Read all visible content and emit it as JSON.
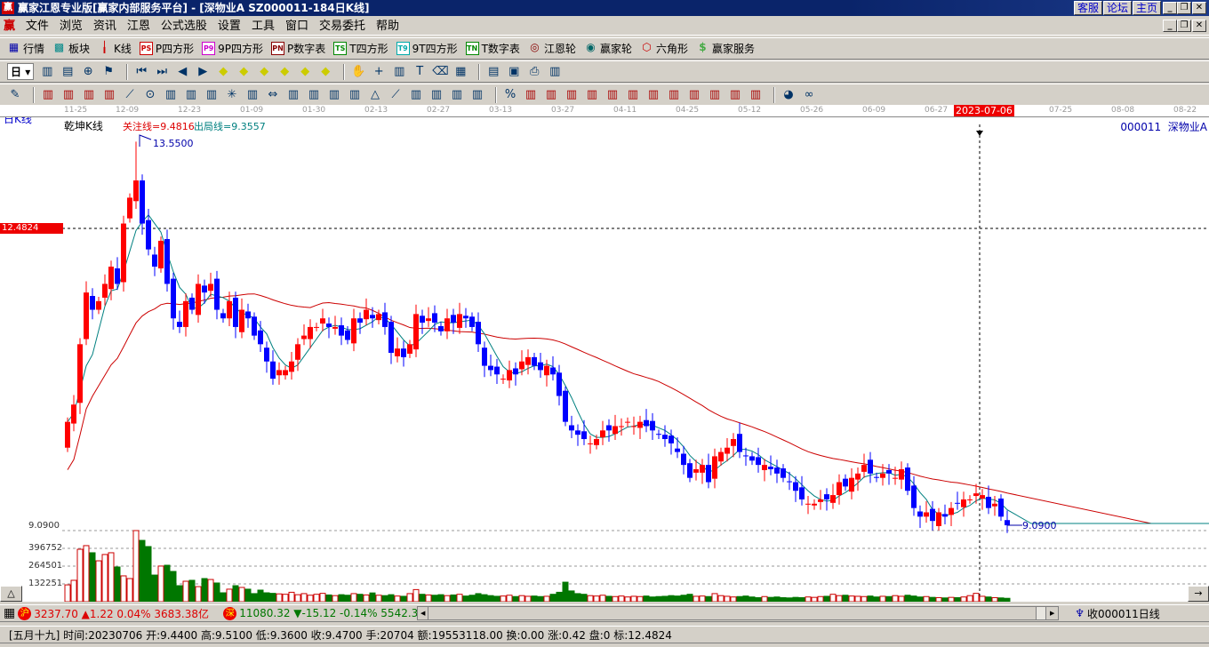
{
  "title": {
    "text": "赢家江恩专业版[赢家内部服务平台] - [深物业A   SZ000011-184日K线]",
    "logo": "赢",
    "links": [
      "客服",
      "论坛",
      "主页"
    ]
  },
  "menu": {
    "logo": "赢",
    "items": [
      "文件",
      "浏览",
      "资讯",
      "江恩",
      "公式选股",
      "设置",
      "工具",
      "窗口",
      "交易委托",
      "帮助"
    ]
  },
  "toolbar1": [
    {
      "icon": "grid-icon",
      "glyph": "▦",
      "label": "行情"
    },
    {
      "icon": "blocks-icon",
      "glyph": "▩",
      "label": "板块"
    },
    {
      "icon": "candles-icon",
      "glyph": "╽",
      "label": "K线"
    },
    {
      "icon": "ps-icon",
      "glyph": "PS",
      "label": "P四方形"
    },
    {
      "icon": "p9-icon",
      "glyph": "P9",
      "label": "9P四方形"
    },
    {
      "icon": "pn-icon",
      "glyph": "PN",
      "label": "P数字表"
    },
    {
      "icon": "ts-icon",
      "glyph": "TS",
      "label": "T四方形"
    },
    {
      "icon": "t9-icon",
      "glyph": "T9",
      "label": "9T四方形"
    },
    {
      "icon": "tn-icon",
      "glyph": "TN",
      "label": "T数字表"
    },
    {
      "icon": "gann-wheel-icon",
      "glyph": "◎",
      "label": "江恩轮"
    },
    {
      "icon": "big-wheel-icon",
      "glyph": "◉",
      "label": "赢家轮"
    },
    {
      "icon": "hexagon-icon",
      "glyph": "⬡",
      "label": "六角形"
    },
    {
      "icon": "dollar-icon",
      "glyph": "$",
      "label": "赢家服务"
    }
  ],
  "toolbar2": {
    "period": "日",
    "icons": [
      "chart-type-icon",
      "list-icon",
      "zoom-icon",
      "flag-icon",
      "first-icon",
      "last-icon",
      "prev-icon",
      "next-icon",
      "diamond-1-icon",
      "diamond-2-icon",
      "diamond-3-icon",
      "diamond-4-icon",
      "diamond-5-icon",
      "diamond-6-icon",
      "hand-icon",
      "cross-icon",
      "line-draw-icon",
      "text-icon",
      "eraser-icon",
      "calendar-icon",
      "calc-icon",
      "save-icon",
      "print-icon",
      "truck-icon"
    ]
  },
  "toolbar3": {
    "icons": [
      "pen-icon",
      "hbar-1-icon",
      "hbar-2-icon",
      "hbar-3-icon",
      "hbar-4-icon",
      "fan-icon",
      "circle-icon",
      "vbar-icon",
      "bracket-icon",
      "angle-icon",
      "star-icon",
      "grid-box-icon",
      "arrows-icon",
      "cycle-icon",
      "cycle-2-icon",
      "channel-icon",
      "speed-icon",
      "triangle-icon",
      "fan-2-icon",
      "grid-2-icon",
      "grid-3-icon",
      "lines-icon",
      "stats-icon",
      "percent-icon",
      "gann-1-icon",
      "gann-2-icon",
      "gann-3-icon",
      "gann-4-icon",
      "gann-5-icon",
      "gann-6-icon",
      "gann-7-icon",
      "gann-8-icon",
      "gann-9-icon",
      "gann-10-icon",
      "gann-11-icon",
      "gann-12-icon",
      "color-icon",
      "infinity-icon"
    ]
  },
  "date_axis": {
    "labels": [
      "11-25",
      "12-09",
      "12-23",
      "01-09",
      "01-30",
      "02-13",
      "02-27",
      "03-13",
      "03-27",
      "04-11",
      "04-25",
      "05-12",
      "05-26",
      "06-09",
      "06-27",
      "2023-07-06",
      "07-25",
      "08-08",
      "08-22"
    ],
    "highlight": "2023-07-06"
  },
  "chart_labels": {
    "period": "日K线",
    "indicator": "乾坤K线",
    "focus_line": "关注线=9.4816",
    "exit_line": "出局线=9.3557",
    "stock": "000011  深物业A",
    "high_label": "13.5500",
    "low_label": "9.0900",
    "crosshair_price": "12.4824",
    "price_axis_low": "9.0900",
    "vol_ticks": [
      "396752",
      "264501",
      "132251"
    ]
  },
  "colors": {
    "up": "#ff0000",
    "down": "#0000ff",
    "ma_short": "#008080",
    "ma_long": "#cc0000",
    "vol_up": "#cc0000",
    "vol_down": "#007700"
  },
  "chart_data": {
    "type": "candlestick",
    "close": [
      10.3,
      10.5,
      11.2,
      11.8,
      11.6,
      11.7,
      11.9,
      12.1,
      11.9,
      12.6,
      12.9,
      13.1,
      12.6,
      12.3,
      12.1,
      12.4,
      11.9,
      11.5,
      11.4,
      11.7,
      11.6,
      11.9,
      11.8,
      11.9,
      11.6,
      11.5,
      11.7,
      11.4,
      11.6,
      11.5,
      11.3,
      11.2,
      11.0,
      10.8,
      10.9,
      10.9,
      11.0,
      11.2,
      11.3,
      11.4,
      11.4,
      11.5,
      11.4,
      11.4,
      11.3,
      11.25,
      11.5,
      11.45,
      11.6,
      11.5,
      11.55,
      11.4,
      11.1,
      11.15,
      11.05,
      11.2,
      11.55,
      11.45,
      11.5,
      11.45,
      11.35,
      11.5,
      11.45,
      11.55,
      11.5,
      11.4,
      11.2,
      10.95,
      10.9,
      10.85,
      10.8,
      10.9,
      10.85,
      11.0,
      11.05,
      10.95,
      10.9,
      10.95,
      10.85,
      10.6,
      10.3,
      10.2,
      10.15,
      10.1,
      10.05,
      10.1,
      10.2,
      10.2,
      10.25,
      10.25,
      10.3,
      10.25,
      10.3,
      10.25,
      10.2,
      10.15,
      10.1,
      10.05,
      9.95,
      9.8,
      9.65,
      9.75,
      9.8,
      9.6,
      9.9,
      9.95,
      10.0,
      10.1,
      9.95,
      9.9,
      9.85,
      9.8,
      9.8,
      9.75,
      9.7,
      9.65,
      9.6,
      9.5,
      9.4,
      9.35,
      9.35,
      9.4,
      9.4,
      9.45,
      9.6,
      9.55,
      9.65,
      9.7,
      9.8,
      9.7,
      9.65,
      9.7,
      9.7,
      9.65,
      9.75,
      9.5,
      9.3,
      9.2,
      9.25,
      9.15,
      9.25,
      9.2,
      9.3,
      9.35,
      9.4,
      9.4,
      9.47,
      9.45,
      9.3,
      9.35,
      9.2,
      9.1
    ],
    "volume": [
      125000,
      159000,
      390000,
      417000,
      364000,
      304000,
      351000,
      364000,
      258000,
      192000,
      172000,
      529000,
      456000,
      410000,
      198000,
      265000,
      271000,
      225000,
      119000,
      152000,
      159000,
      112000,
      172000,
      165000,
      139000,
      66000,
      93000,
      119000,
      106000,
      93000,
      60000,
      86000,
      66000,
      62000,
      58000,
      55000,
      70000,
      52000,
      60000,
      48000,
      55000,
      62000,
      50000,
      45000,
      52000,
      48000,
      60000,
      55000,
      50000,
      65000,
      48000,
      45000,
      52000,
      42000,
      40000,
      60000,
      90000,
      55000,
      50000,
      48000,
      52000,
      45000,
      50000,
      55000,
      42000,
      48000,
      60000,
      52000,
      45000,
      40000,
      42000,
      48000,
      38000,
      45000,
      40000,
      42000,
      38000,
      40000,
      55000,
      70000,
      145000,
      80000,
      60000,
      55000,
      45000,
      42000,
      48000,
      40000,
      38000,
      42000,
      35000,
      40000,
      38000,
      42000,
      35000,
      38000,
      40000,
      45000,
      42000,
      48000,
      55000,
      40000,
      42000,
      38000,
      60000,
      45000,
      40000,
      35000,
      38000,
      42000,
      35000,
      30000,
      38000,
      32000,
      35000,
      30000,
      28000,
      32000,
      30000,
      35000,
      32000,
      38000,
      40000,
      55000,
      45000,
      48000,
      42000,
      40000,
      38000,
      42000,
      35000,
      40000,
      38000,
      45000,
      40000,
      48000,
      42000,
      35000,
      38000,
      32000,
      30000,
      28000,
      32000,
      30000,
      35000,
      45000,
      62000,
      40000,
      35000,
      30000,
      28000,
      25000
    ],
    "price_range": [
      9.09,
      13.55
    ],
    "ma_periods": [
      5,
      40
    ]
  },
  "status1": {
    "sh_label": "沪",
    "sh_text": "3237.70 ▲1.22 0.04% 3683.38亿",
    "sz_label": "深",
    "sz_text": "11080.32 ▼-15.12 -0.14% 5542.3",
    "recv": "收000011日线"
  },
  "status2": {
    "text": "[五月十九] 时间:20230706 开:9.4400 高:9.5100 低:9.3600 收:9.4700 手:20704 额:19553118.00 换:0.00 涨:0.42 盘:0 标:12.4824"
  }
}
